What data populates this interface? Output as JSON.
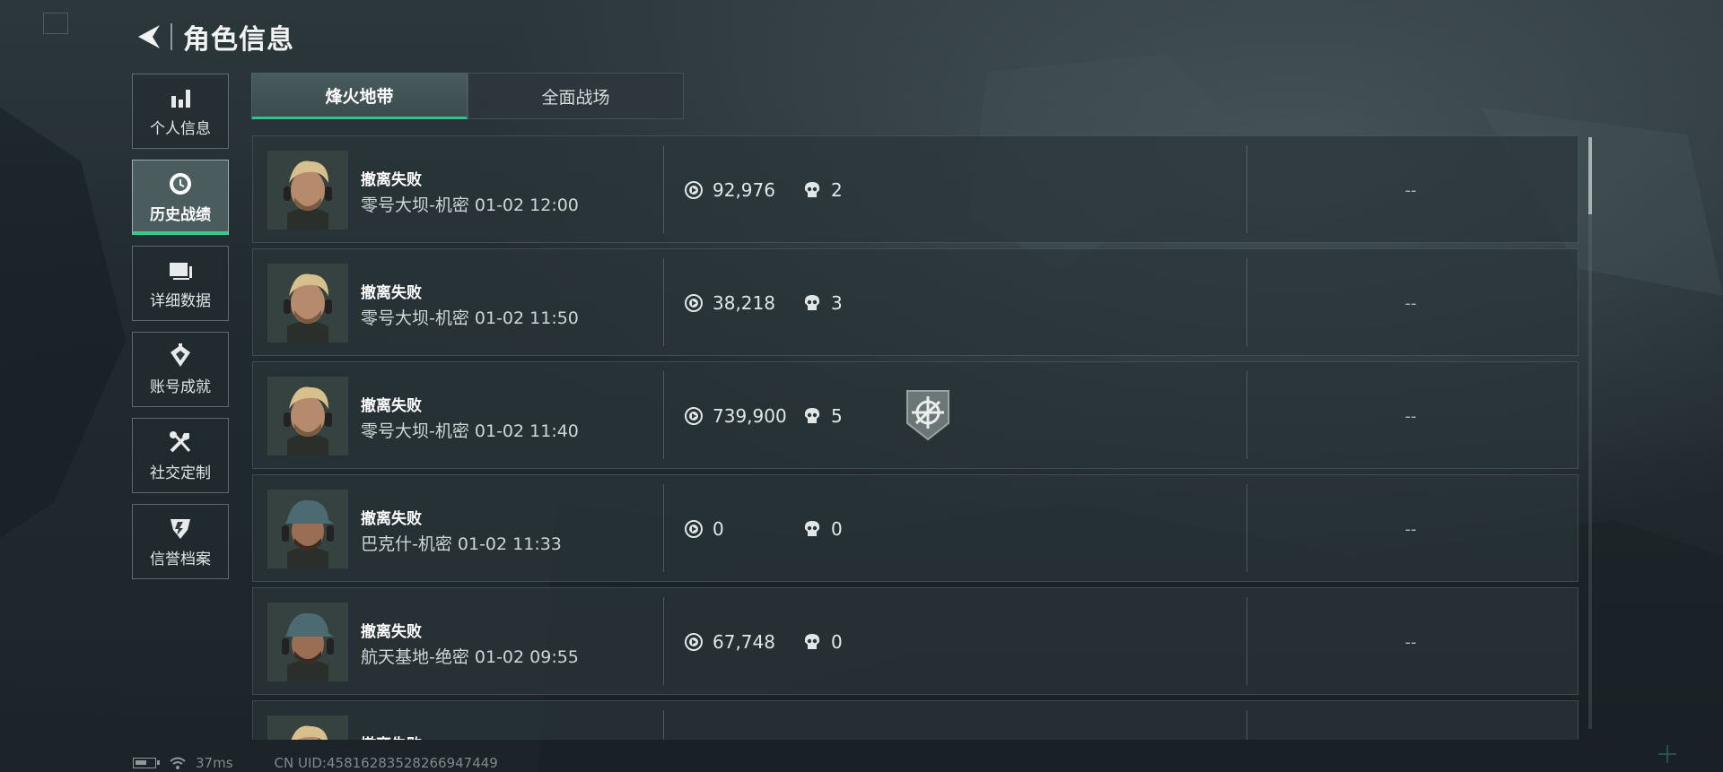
{
  "header": {
    "title": "角色信息",
    "back_icon": "back-arrow-icon"
  },
  "side_nav": {
    "items": [
      {
        "label": "个人信息",
        "icon": "bar-chart-icon",
        "active": false
      },
      {
        "label": "历史战绩",
        "icon": "clock-icon",
        "active": true
      },
      {
        "label": "详细数据",
        "icon": "cards-icon",
        "active": false
      },
      {
        "label": "账号成就",
        "icon": "achievement-icon",
        "active": false
      },
      {
        "label": "社交定制",
        "icon": "tools-icon",
        "active": false
      },
      {
        "label": "信誉档案",
        "icon": "credit-icon",
        "active": false
      }
    ]
  },
  "tabs": [
    {
      "label": "烽火地带",
      "active": true
    },
    {
      "label": "全面战场",
      "active": false
    }
  ],
  "records": [
    {
      "status": "撤离失败",
      "detail": "零号大坝-机密 01-02 12:00",
      "money": "92,976",
      "kills": "2",
      "badge": false,
      "extra": "--",
      "avatar": "blond"
    },
    {
      "status": "撤离失败",
      "detail": "零号大坝-机密 01-02 11:50",
      "money": "38,218",
      "kills": "3",
      "badge": false,
      "extra": "--",
      "avatar": "blond"
    },
    {
      "status": "撤离失败",
      "detail": "零号大坝-机密 01-02 11:40",
      "money": "739,900",
      "kills": "5",
      "badge": true,
      "extra": "--",
      "avatar": "blond"
    },
    {
      "status": "撤离失败",
      "detail": "巴克什-机密 01-02 11:33",
      "money": "0",
      "kills": "0",
      "badge": false,
      "extra": "--",
      "avatar": "cap"
    },
    {
      "status": "撤离失败",
      "detail": "航天基地-绝密 01-02 09:55",
      "money": "67,748",
      "kills": "0",
      "badge": false,
      "extra": "--",
      "avatar": "cap"
    },
    {
      "status": "撤离失败",
      "detail": "",
      "money": "",
      "kills": "",
      "badge": false,
      "extra": "",
      "avatar": "blond"
    }
  ],
  "status_bar": {
    "ping": "37ms",
    "uid": "CN UID:458162835282669​47449"
  },
  "colors": {
    "accent_green": "#38c98b",
    "panel": "#2a3439",
    "text": "#e6eaea"
  }
}
